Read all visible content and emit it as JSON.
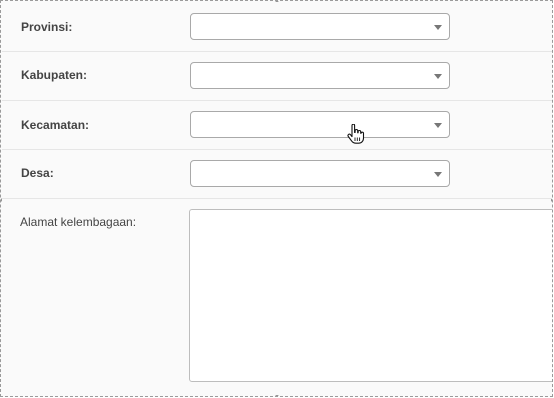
{
  "form": {
    "provinsi": {
      "label": "Provinsi:",
      "value": ""
    },
    "kabupaten": {
      "label": "Kabupaten:",
      "value": ""
    },
    "kecamatan": {
      "label": "Kecamatan:",
      "value": ""
    },
    "desa": {
      "label": "Desa:",
      "value": ""
    },
    "alamat": {
      "label": "Alamat kelembagaan:",
      "value": ""
    }
  },
  "icons": {
    "dropdown": "chevron-down-icon",
    "cursor": "hand-pointer-icon"
  },
  "colors": {
    "border": "#a9a9a9",
    "divider": "#e6e6e6",
    "background": "#fafafa"
  }
}
